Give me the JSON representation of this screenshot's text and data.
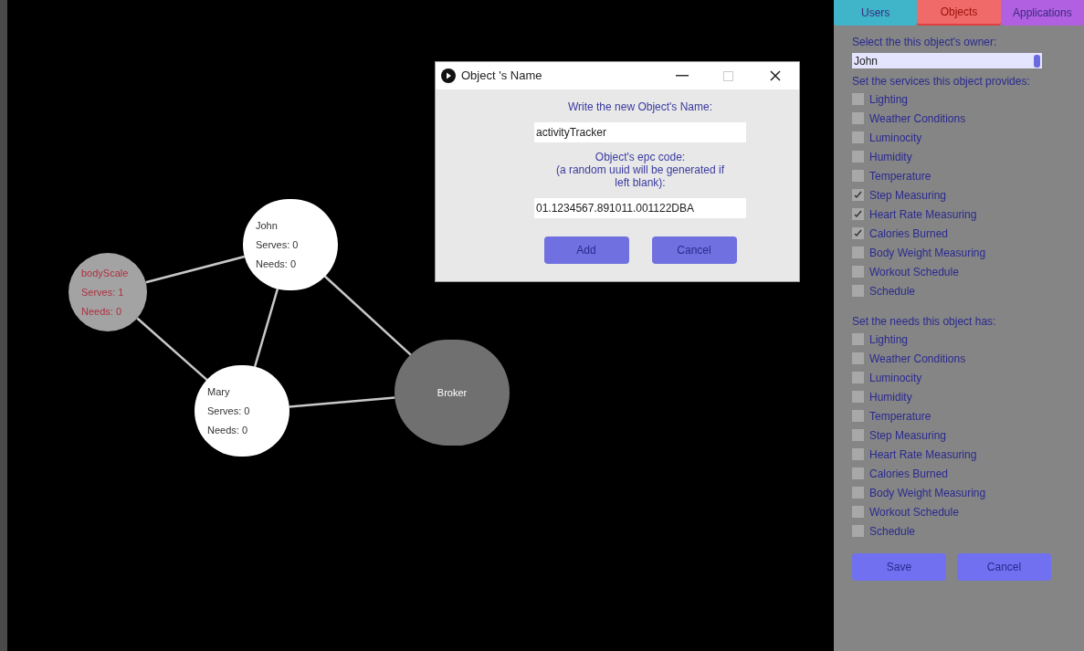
{
  "graph": {
    "nodes": [
      {
        "kind": "object",
        "name": "bodyScale",
        "lines": [
          "Serves: 1",
          "Needs: 0"
        ]
      },
      {
        "kind": "user",
        "name": "John",
        "lines": [
          "Serves: 0",
          "Needs: 0"
        ]
      },
      {
        "kind": "user",
        "name": "Mary",
        "lines": [
          "Serves: 0",
          "Needs: 0"
        ]
      },
      {
        "kind": "broker",
        "name": "Broker"
      }
    ]
  },
  "dialog": {
    "title": "Object 's Name",
    "name_label": "Write the new Object's Name:",
    "name_value": "activityTracker",
    "epc_label": [
      "Object's epc code:",
      "(a random uuid will be generated if",
      "left blank):"
    ],
    "epc_value": "01.1234567.891011.001122DBA",
    "buttons": [
      "Add",
      "Cancel"
    ]
  },
  "panel": {
    "tabs": [
      {
        "label": "Users",
        "selected": false,
        "color": "#40b4c8"
      },
      {
        "label": "Objects",
        "selected": true,
        "color": "#f06a6a"
      },
      {
        "label": "Applications",
        "selected": false,
        "color": "#b060e0"
      }
    ],
    "owner_label": "Select the this object's owner:",
    "owner_value": "John",
    "services_label": "Set the services this object provides:",
    "services": [
      {
        "label": "Lighting",
        "checked": false
      },
      {
        "label": "Weather Conditions",
        "checked": false
      },
      {
        "label": "Luminocity",
        "checked": false
      },
      {
        "label": "Humidity",
        "checked": false
      },
      {
        "label": "Temperature",
        "checked": false
      },
      {
        "label": "Step Measuring",
        "checked": true
      },
      {
        "label": "Heart Rate Measuring",
        "checked": true
      },
      {
        "label": "Calories Burned",
        "checked": true
      },
      {
        "label": "Body Weight Measuring",
        "checked": false
      },
      {
        "label": "Workout Schedule",
        "checked": false
      },
      {
        "label": "Schedule",
        "checked": false
      }
    ],
    "needs_label": "Set the needs this object has:",
    "needs": [
      {
        "label": "Lighting",
        "checked": false
      },
      {
        "label": "Weather Conditions",
        "checked": false
      },
      {
        "label": "Luminocity",
        "checked": false
      },
      {
        "label": "Humidity",
        "checked": false
      },
      {
        "label": "Temperature",
        "checked": false
      },
      {
        "label": "Step Measuring",
        "checked": false
      },
      {
        "label": "Heart Rate Measuring",
        "checked": false
      },
      {
        "label": "Calories Burned",
        "checked": false
      },
      {
        "label": "Body Weight Measuring",
        "checked": false
      },
      {
        "label": "Workout Schedule",
        "checked": false
      },
      {
        "label": "Schedule",
        "checked": false
      }
    ],
    "buttons": [
      "Save",
      "Cancel"
    ]
  }
}
